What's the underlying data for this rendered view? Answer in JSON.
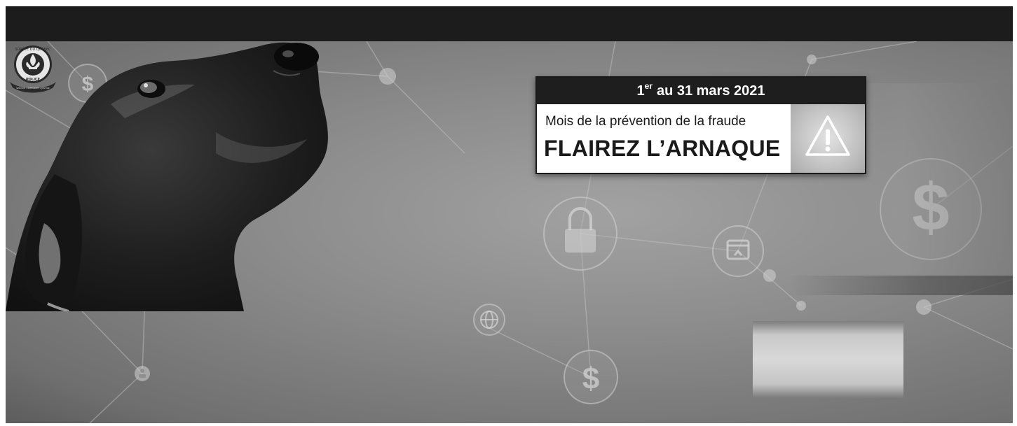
{
  "card": {
    "date_day": "1",
    "date_suffix": "er",
    "date_rest": "au 31 mars 2021",
    "subtitle": "Mois de la prévention de la fraude",
    "headline": "FLAIREZ L’ARNAQUE"
  },
  "logo": {
    "text_ring": "SÛRETÉ DU QUÉBEC",
    "text_center": "POLICE",
    "motto": "SERVICE • INTÉGRITÉ • JUSTICE"
  },
  "icons": {
    "dollar": "$",
    "at": "@"
  }
}
